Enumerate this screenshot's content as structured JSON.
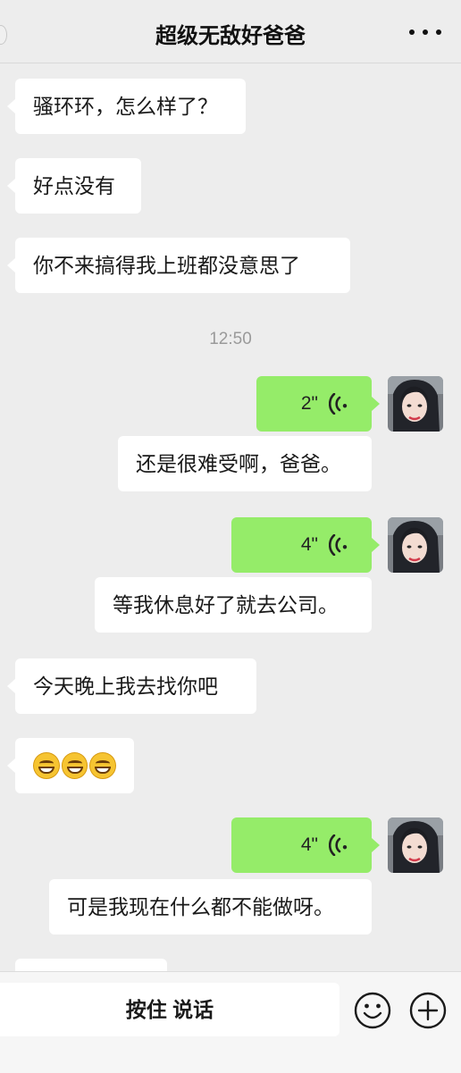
{
  "header": {
    "title": "超级无敌好爸爸",
    "more_icon": "more-dots-icon"
  },
  "messages": {
    "m1": "骚环环，怎么样了？",
    "m2": "好点没有",
    "m3": "你不来搞得我上班都没意思了",
    "timestamp": "12:50",
    "v1": "2\"",
    "m4": "还是很难受啊，爸爸。",
    "v2": "4\"",
    "m5": "等我休息好了就去公司。",
    "m6": "今天晚上我去找你吧",
    "m7_emojis": [
      "grinning-squint-emoji",
      "grinning-squint-emoji",
      "grinning-squint-emoji"
    ],
    "v3": "4\"",
    "m8": "可是我现在什么都不能做呀。"
  },
  "input_bar": {
    "hold_to_talk": "按住 说话",
    "emoji_icon": "smiley-icon",
    "plus_icon": "plus-icon"
  },
  "colors": {
    "background": "#ededed",
    "incoming_bubble": "#ffffff",
    "voice_bubble": "#95ec69"
  }
}
